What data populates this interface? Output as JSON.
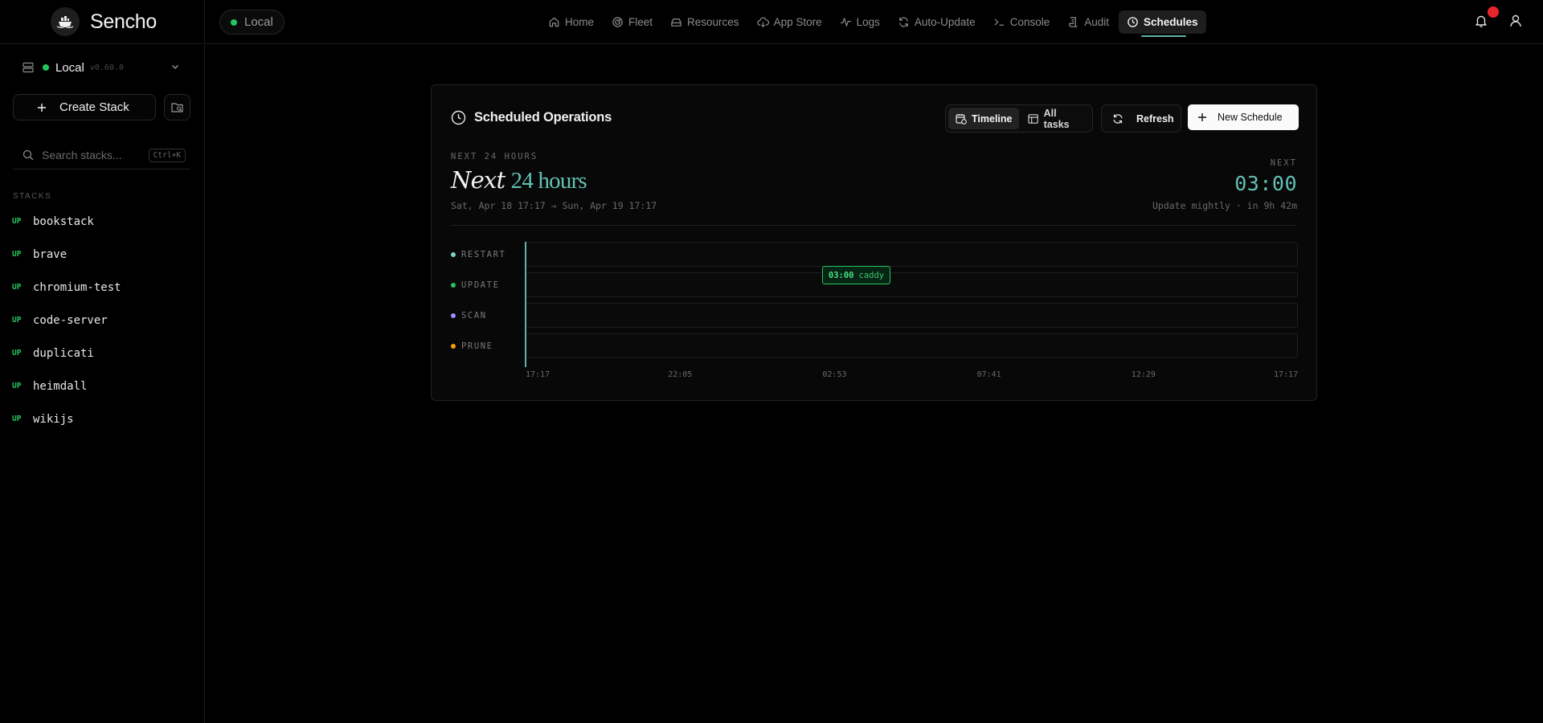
{
  "app": {
    "name": "Sencho"
  },
  "node_pill": {
    "label": "Local"
  },
  "nav": [
    {
      "label": "Home",
      "icon": "home-icon"
    },
    {
      "label": "Fleet",
      "icon": "fleet-icon"
    },
    {
      "label": "Resources",
      "icon": "resources-icon"
    },
    {
      "label": "App Store",
      "icon": "app-store-icon"
    },
    {
      "label": "Logs",
      "icon": "logs-icon"
    },
    {
      "label": "Auto-Update",
      "icon": "auto-update-icon"
    },
    {
      "label": "Console",
      "icon": "console-icon"
    },
    {
      "label": "Audit",
      "icon": "audit-icon"
    },
    {
      "label": "Schedules",
      "icon": "clock-icon",
      "active": true
    }
  ],
  "sidebar": {
    "node": {
      "name": "Local",
      "version": "v0.60.0"
    },
    "create_label": "Create Stack",
    "search": {
      "placeholder": "Search stacks...",
      "shortcut": "Ctrl+K"
    },
    "stacks_heading": "STACKS",
    "stacks": [
      {
        "status": "UP",
        "name": "bookstack"
      },
      {
        "status": "UP",
        "name": "brave"
      },
      {
        "status": "UP",
        "name": "chromium-test"
      },
      {
        "status": "UP",
        "name": "code-server"
      },
      {
        "status": "UP",
        "name": "duplicati"
      },
      {
        "status": "UP",
        "name": "heimdall"
      },
      {
        "status": "UP",
        "name": "wikijs"
      }
    ]
  },
  "card": {
    "title": "Scheduled Operations",
    "view_timeline": "Timeline",
    "view_all": "All tasks",
    "refresh": "Refresh",
    "new_schedule": "New Schedule",
    "eyebrow": "NEXT 24 HOURS",
    "headline_a": "Next",
    "headline_b": "24 hours",
    "range": "Sat, Apr 18 17:17 → Sun, Apr 19 17:17",
    "next_label": "NEXT",
    "next_time": "03:00",
    "next_desc": "Update mightly · in 9h 42m"
  },
  "timeline": {
    "lanes": [
      {
        "label": "RESTART",
        "color": "#7dd3c7"
      },
      {
        "label": "UPDATE",
        "color": "#22c55e"
      },
      {
        "label": "SCAN",
        "color": "#a78bfa"
      },
      {
        "label": "PRUNE",
        "color": "#f59e0b"
      }
    ],
    "ticks": [
      "17:17",
      "22:05",
      "02:53",
      "07:41",
      "12:29",
      "17:17"
    ],
    "start_minute": 1037,
    "span_minutes": 1440,
    "events": [
      {
        "lane": 1,
        "time": "03:00",
        "minute": 1620,
        "name": "caddy"
      }
    ]
  },
  "colors": {
    "accent": "#5eb3a8",
    "up": "#22c55e",
    "badge": "#e5252a"
  }
}
